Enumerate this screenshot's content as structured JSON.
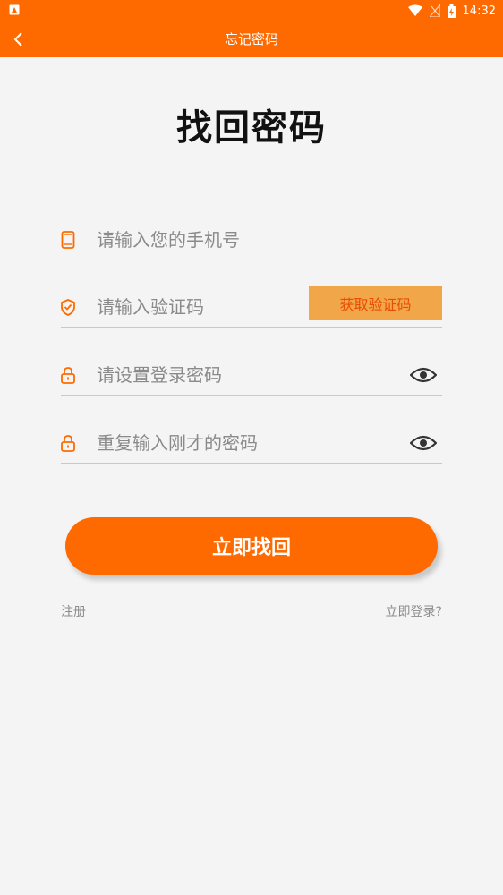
{
  "status_bar": {
    "time": "14:32"
  },
  "header": {
    "title": "忘记密码"
  },
  "page_heading": "找回密码",
  "form": {
    "phone_placeholder": "请输入您的手机号",
    "code_placeholder": "请输入验证码",
    "get_code_label": "获取验证码",
    "password_placeholder": "请设置登录密码",
    "confirm_placeholder": "重复输入刚才的密码"
  },
  "submit_label": "立即找回",
  "footer": {
    "register": "注册",
    "login": "立即登录?"
  },
  "colors": {
    "accent": "#ff6a00",
    "code_button_bg": "#f2a64a",
    "code_button_text": "#e84e00"
  },
  "icons": [
    "back-icon",
    "phone-icon",
    "shield-icon",
    "lock-icon",
    "eye-icon",
    "wifi-icon",
    "signal-icon",
    "battery-icon"
  ]
}
